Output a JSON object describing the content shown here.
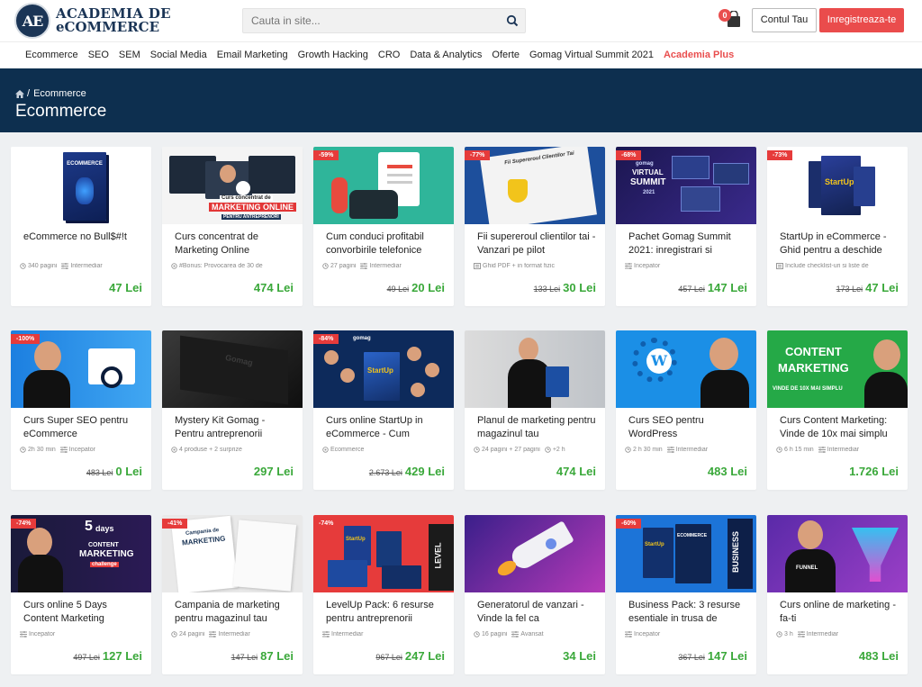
{
  "brand": {
    "logo_mark": "AE",
    "line1": "ACADEMIA DE",
    "line2": "eCOMMERCE"
  },
  "search": {
    "placeholder": "Cauta in site..."
  },
  "cart": {
    "count": "0"
  },
  "header_buttons": {
    "account": "Contul Tau",
    "register": "Inregistreaza-te"
  },
  "nav": {
    "items": [
      "Ecommerce",
      "SEO",
      "SEM",
      "Social Media",
      "Email Marketing",
      "Growth Hacking",
      "CRO",
      "Data & Analytics",
      "Oferte",
      "Gomag Virtual Summit 2021"
    ],
    "plus": "Academia Plus"
  },
  "hero": {
    "breadcrumb_sep": "/",
    "breadcrumb": "Ecommerce",
    "title": "Ecommerce"
  },
  "colors": {
    "accent": "#e94e4e",
    "hero_bg": "#0d2f4f",
    "price_green": "#3aa83a"
  },
  "products": [
    {
      "title": "eCommerce no Bull$#!t",
      "discount": "",
      "meta": [
        [
          "book-icon",
          "340 pagini"
        ],
        [
          "level-icon",
          "Intermediar"
        ]
      ],
      "old": "",
      "price": "47 Lei"
    },
    {
      "title": "Curs concentrat de Marketing Online",
      "discount": "",
      "meta": [
        [
          "gift-icon",
          "#Bonus: Provocarea de 30 de"
        ]
      ],
      "old": "",
      "price": "474 Lei"
    },
    {
      "title": "Cum conduci profitabil convorbirile telefonice",
      "discount": "-59%",
      "meta": [
        [
          "book-icon",
          "27 pagini"
        ],
        [
          "level-icon",
          "Intermediar"
        ]
      ],
      "old": "49 Lei",
      "price": "20 Lei"
    },
    {
      "title": "Fii supereroul clientilor tai - Vanzari pe pilot",
      "discount": "-77%",
      "meta": [
        [
          "file-icon",
          "Ghid PDF + in format fizic"
        ]
      ],
      "old": "133 Lei",
      "price": "30 Lei"
    },
    {
      "title": "Pachet Gomag Summit 2021: inregistrari si",
      "discount": "-68%",
      "meta": [
        [
          "level-icon",
          "Incepator"
        ]
      ],
      "old": "457 Lei",
      "price": "147 Lei"
    },
    {
      "title": "StartUp in eCommerce - Ghid pentru a deschide",
      "discount": "-73%",
      "meta": [
        [
          "file-icon",
          "Include checklist-uri si liste de"
        ]
      ],
      "old": "173 Lei",
      "price": "47 Lei"
    },
    {
      "title": "Curs Super SEO pentru eCommerce",
      "discount": "-100%",
      "meta": [
        [
          "clock-icon",
          "2h 30 min"
        ],
        [
          "level-icon",
          "Incepator"
        ]
      ],
      "old": "483 Lei",
      "price": "0 Lei"
    },
    {
      "title": "Mystery Kit Gomag - Pentru antreprenorii",
      "discount": "",
      "meta": [
        [
          "box-icon",
          "4 produse + 2 surprize"
        ]
      ],
      "old": "",
      "price": "297 Lei"
    },
    {
      "title": "Curs online StartUp in eCommerce - Cum",
      "discount": "-84%",
      "meta": [
        [
          "tag-icon",
          "Ecommerce"
        ]
      ],
      "old": "2.673 Lei",
      "price": "429 Lei"
    },
    {
      "title": "Planul de marketing pentru magazinul tau",
      "discount": "",
      "meta": [
        [
          "book-icon",
          "24 pagini + 27 pagini"
        ],
        [
          "clock-icon",
          "+2 h"
        ]
      ],
      "old": "",
      "price": "474 Lei"
    },
    {
      "title": "Curs SEO pentru WordPress",
      "discount": "",
      "meta": [
        [
          "clock-icon",
          "2 h 30 min"
        ],
        [
          "level-icon",
          "Intermediar"
        ]
      ],
      "old": "",
      "price": "483 Lei"
    },
    {
      "title": "Curs Content Marketing: Vinde de 10x mai simplu",
      "discount": "",
      "meta": [
        [
          "clock-icon",
          "6 h 15 min"
        ],
        [
          "level-icon",
          "Intermediar"
        ]
      ],
      "old": "",
      "price": "1.726 Lei"
    },
    {
      "title": "Curs online 5 Days Content Marketing",
      "discount": "-74%",
      "meta": [
        [
          "level-icon",
          "Incepator"
        ]
      ],
      "old": "497 Lei",
      "price": "127 Lei"
    },
    {
      "title": "Campania de marketing pentru magazinul tau",
      "discount": "-41%",
      "meta": [
        [
          "book-icon",
          "24 pagini"
        ],
        [
          "level-icon",
          "Intermediar"
        ]
      ],
      "old": "147 Lei",
      "price": "87 Lei"
    },
    {
      "title": "LevelUp Pack: 6 resurse pentru antreprenorii",
      "discount": "-74%",
      "meta": [
        [
          "level-icon",
          "Intermediar"
        ]
      ],
      "old": "967 Lei",
      "price": "247 Lei"
    },
    {
      "title": "Generatorul de vanzari - Vinde la fel ca",
      "discount": "",
      "meta": [
        [
          "book-icon",
          "16 pagini"
        ],
        [
          "level-icon",
          "Avansat"
        ]
      ],
      "old": "",
      "price": "34 Lei"
    },
    {
      "title": "Business Pack: 3 resurse esentiale in trusa de",
      "discount": "-60%",
      "meta": [
        [
          "level-icon",
          "Incepator"
        ]
      ],
      "old": "367 Lei",
      "price": "147 Lei"
    },
    {
      "title": "Curs online de marketing - fa-ti",
      "discount": "",
      "meta": [
        [
          "clock-icon",
          "3 h"
        ],
        [
          "level-icon",
          "Intermediar"
        ]
      ],
      "old": "",
      "price": "483 Lei"
    }
  ],
  "thumb_texts": {
    "t0": "ECOMMERCE",
    "t1": "Curs concentrat de",
    "t1b": "MARKETING ONLINE",
    "t1c": "PENTRU ANTREPRENORI",
    "t3": "Fii Supereroul Clientilor Tai",
    "t4a": "gomag",
    "t4b": "VIRTUAL",
    "t4c": "SUMMIT",
    "t4d": "2021",
    "t5": "StartUp",
    "t7": "Gomag",
    "t8a": "gomag",
    "t8b": "StartUp",
    "t11a": "CONTENT",
    "t11b": "MARKETING",
    "t11c": "VINDE DE 10X MAI SIMPLU",
    "t12a": "5",
    "t12b": "days",
    "t12c": "CONTENT",
    "t12d": "MARKETING",
    "t12e": "challenge",
    "t13a": "Campania de",
    "t13b": "MARKETING",
    "t14a": "LEVEL",
    "t14b": "StartUp",
    "t16a": "BUSINESS",
    "t16b": "StartUp",
    "t16c": "ECOMMERCE",
    "t17": "FUNNEL"
  }
}
